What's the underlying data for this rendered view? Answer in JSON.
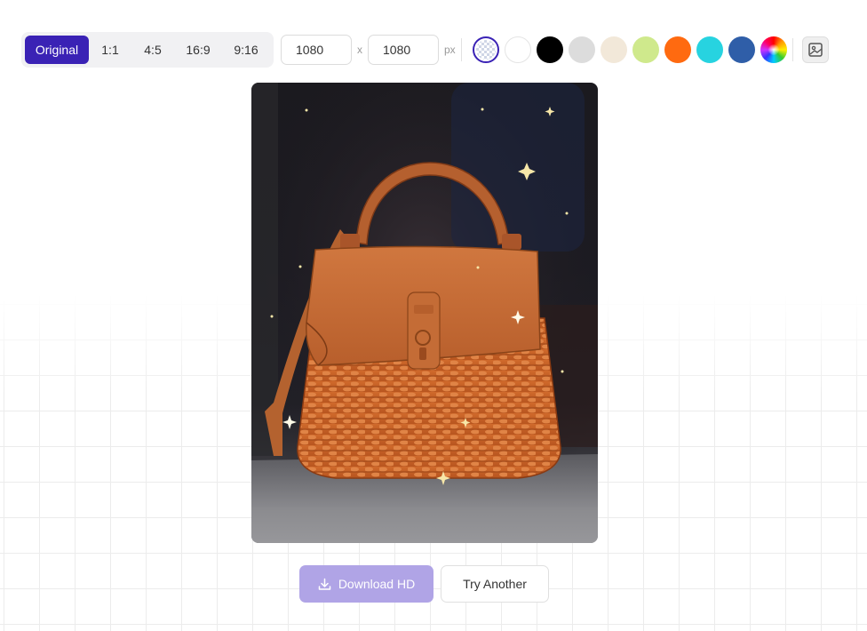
{
  "toolbar": {
    "ratios": [
      {
        "label": "Original",
        "active": true
      },
      {
        "label": "1:1",
        "active": false
      },
      {
        "label": "4:5",
        "active": false
      },
      {
        "label": "16:9",
        "active": false
      },
      {
        "label": "9:16",
        "active": false
      }
    ],
    "width_value": "1080",
    "height_value": "1080",
    "times_symbol": "x",
    "unit": "px",
    "swatches": [
      {
        "name": "transparent",
        "color": "transparent",
        "selected": true
      },
      {
        "name": "white",
        "color": "#ffffff"
      },
      {
        "name": "black",
        "color": "#000000"
      },
      {
        "name": "light-gray",
        "color": "#dcdcdc"
      },
      {
        "name": "cream",
        "color": "#f2e8d9"
      },
      {
        "name": "lime",
        "color": "#cfe98c"
      },
      {
        "name": "orange",
        "color": "#ff6a10"
      },
      {
        "name": "cyan",
        "color": "#27d3e0"
      },
      {
        "name": "blue",
        "color": "#2f5ea8"
      },
      {
        "name": "custom-color-picker",
        "color": "rainbow"
      }
    ],
    "image_background_icon": "image-icon"
  },
  "preview": {
    "subject": "wicker-handbag-image",
    "accent_color": "#3a22b5"
  },
  "actions": {
    "download_label": "Download HD",
    "download_icon": "download-icon",
    "try_another_label": "Try Another"
  }
}
